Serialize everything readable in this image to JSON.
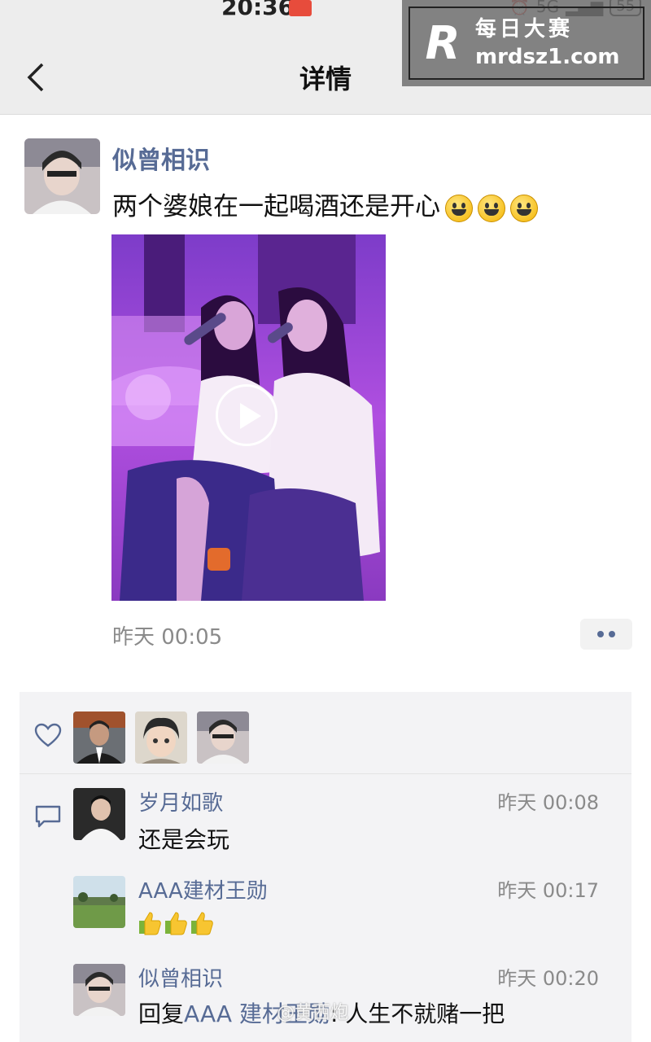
{
  "status_bar": {
    "time": "20:36",
    "network": "5G",
    "battery": "55"
  },
  "header": {
    "title": "详情"
  },
  "watermark": {
    "name": "每日大赛",
    "url": "mrdsz1.com",
    "logo": "R"
  },
  "post": {
    "author": "似曾相识",
    "text": "两个婆娘在一起喝酒还是开心",
    "emoji_count": 3,
    "timestamp": "昨天 00:05"
  },
  "likes": {
    "count": 3
  },
  "comments": [
    {
      "author": "岁月如歌",
      "time": "昨天 00:08",
      "text": "还是会玩"
    },
    {
      "author": "AAA建材王勋",
      "time": "昨天 00:17",
      "text": ""
    },
    {
      "author": "似曾相识",
      "time": "昨天 00:20",
      "reply_prefix": "回复",
      "reply_to": "AAA 建材王勋",
      "text": ": 人生不就赌一把"
    }
  ],
  "credit": "@黄西炮",
  "colors": {
    "link": "#576b95",
    "header_bg": "#ededed",
    "panel_bg": "#f3f3f5",
    "video_tint": "#a44bd6"
  }
}
